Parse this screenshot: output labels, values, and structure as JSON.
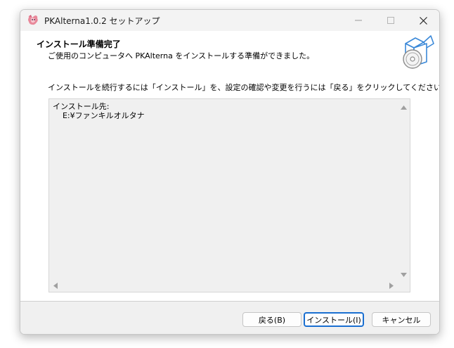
{
  "window": {
    "title": "PKAlterna1.0.2 セットアップ",
    "icons": {
      "app": "app-logo-icon",
      "minimize": "minimize-icon",
      "maximize": "maximize-icon",
      "close": "close-icon"
    }
  },
  "header": {
    "title": "インストール準備完了",
    "subtitle": "ご使用のコンピュータへ PKAlterna をインストールする準備ができました。",
    "image_icon": "box-with-disc-icon"
  },
  "body": {
    "instruction": "インストールを続行するには「インストール」を、設定の確認や変更を行うには「戻る」をクリックしてください。",
    "memo": {
      "line1": "インストール先:",
      "line2": "    E:¥ファンキルオルタナ"
    }
  },
  "buttons": {
    "back": "戻る(B)",
    "install": "インストール(I)",
    "cancel": "キャンセル"
  },
  "colors": {
    "accent": "#1a6fd1",
    "footer_bg": "#f0f0f0",
    "memo_bg": "#f0f0f0"
  }
}
